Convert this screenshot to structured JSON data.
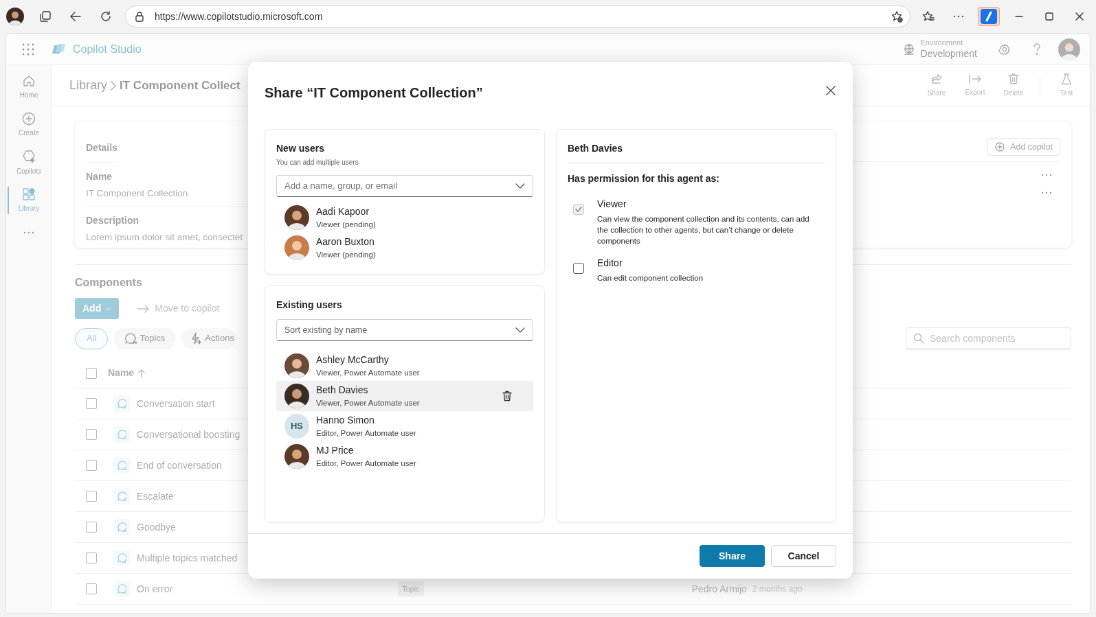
{
  "browser": {
    "url": "https://www.copilotstudio.microsoft.com"
  },
  "app": {
    "name": "Copilot Studio",
    "environment_label": "Environment",
    "environment": "Development"
  },
  "nav": [
    {
      "label": "Home",
      "selected": false
    },
    {
      "label": "Create",
      "selected": false
    },
    {
      "label": "Copilots",
      "selected": false
    },
    {
      "label": "Library",
      "selected": true
    }
  ],
  "breadcrumb": [
    "Library",
    "IT Component Collect"
  ],
  "toolbar": [
    {
      "label": "Share"
    },
    {
      "label": "Export"
    },
    {
      "label": "Delete"
    },
    {
      "label": "Test"
    }
  ],
  "details": {
    "heading": "Details",
    "fields": [
      {
        "label": "Name",
        "value": "IT Component Collection"
      },
      {
        "label": "Description",
        "value": "Lorem ipsum dolor sit amet, consectet"
      }
    ],
    "add_button": "Add copilot"
  },
  "components": {
    "heading": "Components",
    "add": "Add",
    "move": {
      "label": "Move to copilot",
      "disabled": true
    },
    "filters": [
      {
        "label": "All",
        "selected": true
      },
      {
        "label": "Topics",
        "selected": false
      },
      {
        "label": "Actions",
        "selected": false
      }
    ],
    "search_placeholder": "Search components",
    "name_column": "Name",
    "all_checked": false,
    "rows": [
      {
        "name": "Conversation start",
        "checked": false
      },
      {
        "name": "Conversational boosting",
        "checked": false
      },
      {
        "name": "End of conversation",
        "checked": false
      },
      {
        "name": "Escalate",
        "checked": false
      },
      {
        "name": "Goodbye",
        "checked": false
      },
      {
        "name": "Multiple topics matched",
        "checked": false
      },
      {
        "name": "On error",
        "checked": false,
        "type": "Topic",
        "owner": "Pedro Armijo",
        "modified": "2 months ago"
      }
    ]
  },
  "dialog": {
    "title": "Share “IT Component Collection”",
    "new_users": {
      "heading": "New users",
      "hint": "You can add multiple users",
      "placeholder": "Add a name, group, or email",
      "users": [
        {
          "name": "Aadi Kapoor",
          "role": "Viewer (pending)",
          "kind": "photo"
        },
        {
          "name": "Aaron Buxton",
          "role": "Viewer (pending)",
          "kind": "photo"
        }
      ]
    },
    "existing_users": {
      "heading": "Existing users",
      "sort_placeholder": "Sort existing by name",
      "users": [
        {
          "name": "Ashley McCarthy",
          "role": "Viewer, Power Automate user",
          "kind": "photo",
          "selected": false
        },
        {
          "name": "Beth Davies",
          "role": "Viewer, Power Automate user",
          "kind": "photo",
          "selected": true
        },
        {
          "name": "Hanno Simon",
          "role": "Editor, Power Automate user",
          "kind": "initials",
          "initials": "HS",
          "selected": false
        },
        {
          "name": "MJ Price",
          "role": "Editor, Power Automate user",
          "kind": "photo",
          "selected": false
        }
      ]
    },
    "permissions_panel": {
      "user": "Beth Davies",
      "heading": "Has permission for this agent as:",
      "options": [
        {
          "label": "Viewer",
          "description": "Can view the component collection and its contents, can add the collection to other agents, but can’t change or delete components",
          "checked": true,
          "disabled": true
        },
        {
          "label": "Editor",
          "description": "Can edit component collection",
          "checked": false,
          "disabled": false
        }
      ]
    },
    "buttons": [
      {
        "label": "Share",
        "kind": "primary"
      },
      {
        "label": "Cancel",
        "kind": "secondary"
      }
    ]
  }
}
